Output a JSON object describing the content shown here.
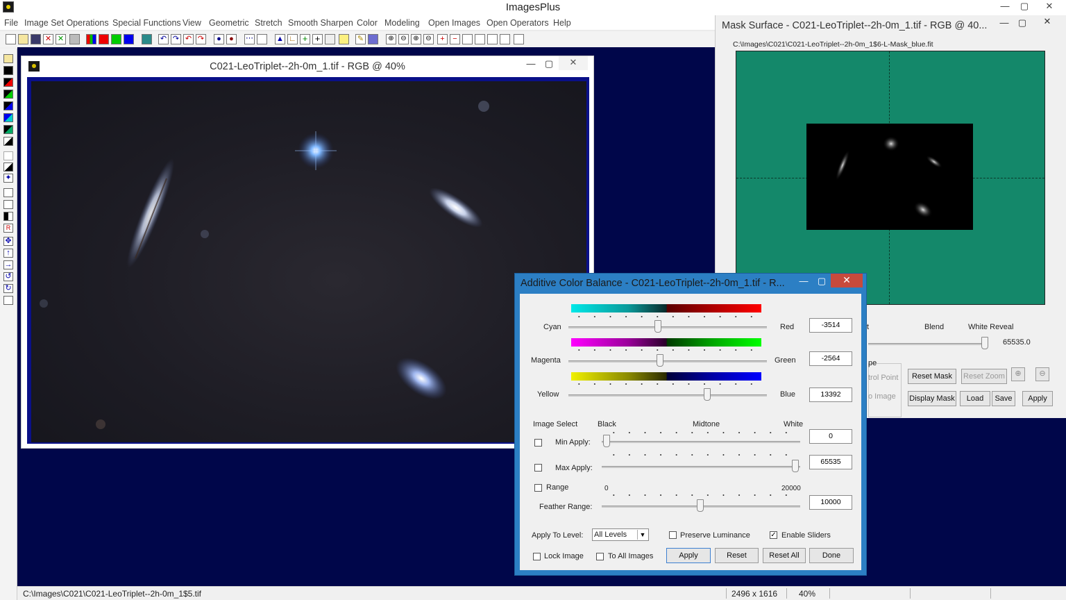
{
  "app": {
    "title": "ImagesPlus",
    "window_buttons": {
      "minimize": "—",
      "maximize": "▢",
      "close": "✕"
    }
  },
  "menu": [
    "File",
    "Image Set Operations",
    "Special Functions",
    "View",
    "Geometric",
    "Stretch",
    "Smooth Sharpen",
    "Color",
    "Modeling",
    "Open Images",
    "Open Operators",
    "Help"
  ],
  "image_window": {
    "title": "C021-LeoTriplet--2h-0m_1.tif - RGB @ 40%"
  },
  "mask_window": {
    "title": "Mask Surface - C021-LeoTriplet--2h-0m_1.tif - RGB @ 40...",
    "path": "C:\\Images\\C021\\C021-LeoTriplet--2h-0m_1$6-L-Mask_blue.fit",
    "labels": {
      "partial_left": "t",
      "blend": "Blend",
      "white_reveal": "White Reveal",
      "white_reveal_value": "65535.0"
    },
    "group": {
      "title": "pe",
      "option1": "trol Point",
      "option2": "o Image"
    },
    "buttons": {
      "reset_mask": "Reset Mask",
      "reset_zoom": "Reset Zoom",
      "display_mask": "Display Mask",
      "load": "Load",
      "save": "Save",
      "apply": "Apply"
    }
  },
  "dialog": {
    "title": "Additive Color Balance - C021-LeoTriplet--2h-0m_1.tif - R...",
    "sliders": [
      {
        "left": "Cyan",
        "right": "Red",
        "value": "-3514",
        "level": 0.45
      },
      {
        "left": "Magenta",
        "right": "Green",
        "value": "-2564",
        "level": 0.46
      },
      {
        "left": "Yellow",
        "right": "Blue",
        "value": "13392",
        "level": 0.7
      }
    ],
    "image_select": {
      "title": "Image Select",
      "black": "Black",
      "midtone": "Midtone",
      "white": "White",
      "min_apply": "Min Apply:",
      "min_value": "0",
      "max_apply": "Max Apply:",
      "max_value": "65535",
      "range": "Range",
      "range_min": "0",
      "range_max": "20000",
      "feather_range": "Feather Range:",
      "feather_value": "10000"
    },
    "apply_to_level": {
      "label": "Apply To Level:",
      "selected": "All Levels"
    },
    "preserve_luminance": "Preserve Luminance",
    "enable_sliders": "Enable Sliders",
    "lock_image": "Lock Image",
    "to_all_images": "To All Images",
    "buttons": {
      "apply": "Apply",
      "reset": "Reset",
      "reset_all": "Reset All",
      "done": "Done"
    }
  },
  "status_bar": {
    "path": "C:\\Images\\C021\\C021-LeoTriplet--2h-0m_1$5.tif",
    "dimensions": "2496 x 1616",
    "zoom": "40%"
  }
}
